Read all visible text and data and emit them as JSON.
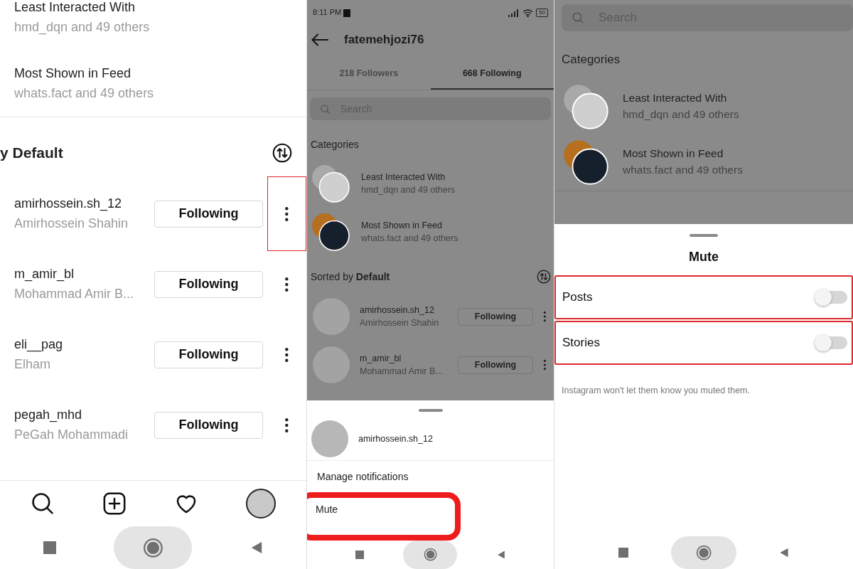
{
  "left_screen": {
    "categories": [
      {
        "title": "Least Interacted With",
        "subtitle": "hmd_dqn and 49 others"
      },
      {
        "title": "Most Shown in Feed",
        "subtitle": "whats.fact and 49 others"
      }
    ],
    "sort_heading": "y Default",
    "users": [
      {
        "username": "amirhossein.sh_12",
        "full_name": "Amirhossein Shahin",
        "button": "Following",
        "highlighted": true
      },
      {
        "username": "m_amir_bl",
        "full_name": "Mohammad Amir B...",
        "button": "Following",
        "highlighted": false
      },
      {
        "username": "eli__pag",
        "full_name": "Elham",
        "button": "Following",
        "highlighted": false
      },
      {
        "username": "pegah_mhd",
        "full_name": "PeGah Mohammadi",
        "button": "Following",
        "highlighted": false
      }
    ]
  },
  "middle_screen": {
    "status_time": "8:11 PM",
    "battery": "50",
    "title": "fatemehjozi76",
    "tabs": [
      {
        "label": "218 Followers",
        "selected": false
      },
      {
        "label": "668 Following",
        "selected": true
      }
    ],
    "search": {
      "placeholder": "Search"
    },
    "categories_heading": "Categories",
    "categories": [
      {
        "title": "Least Interacted With",
        "subtitle": "hmd_dqn and 49 others"
      },
      {
        "title": "Most Shown in Feed",
        "subtitle": "whats.fact and 49 others"
      }
    ],
    "sort_heading": "Sorted by **Default**",
    "users": [
      {
        "username": "amirhossein.sh_12",
        "full_name": "Amirhossein Shahin",
        "button": "Following"
      },
      {
        "username": "m_amir_bl",
        "full_name": "Mohammad Amir B...",
        "button": "Following"
      }
    ],
    "sheet": {
      "username": "amirhossein.sh_12",
      "options": [
        {
          "label": "Manage notifications",
          "highlighted": false
        },
        {
          "label": "Mute",
          "highlighted": true
        }
      ]
    }
  },
  "right_screen": {
    "search": {
      "placeholder": "Search"
    },
    "categories_heading": "Categories",
    "categories": [
      {
        "title": "Least Interacted With",
        "subtitle": "hmd_dqn and 49 others"
      },
      {
        "title": "Most Shown in Feed",
        "subtitle": "whats.fact and 49 others"
      }
    ],
    "sheet": {
      "title": "Mute",
      "options": [
        {
          "label": "Posts",
          "on": false,
          "highlighted": true
        },
        {
          "label": "Stories",
          "on": false,
          "highlighted": true
        }
      ],
      "note": "Instagram won't let them know you muted them."
    }
  }
}
